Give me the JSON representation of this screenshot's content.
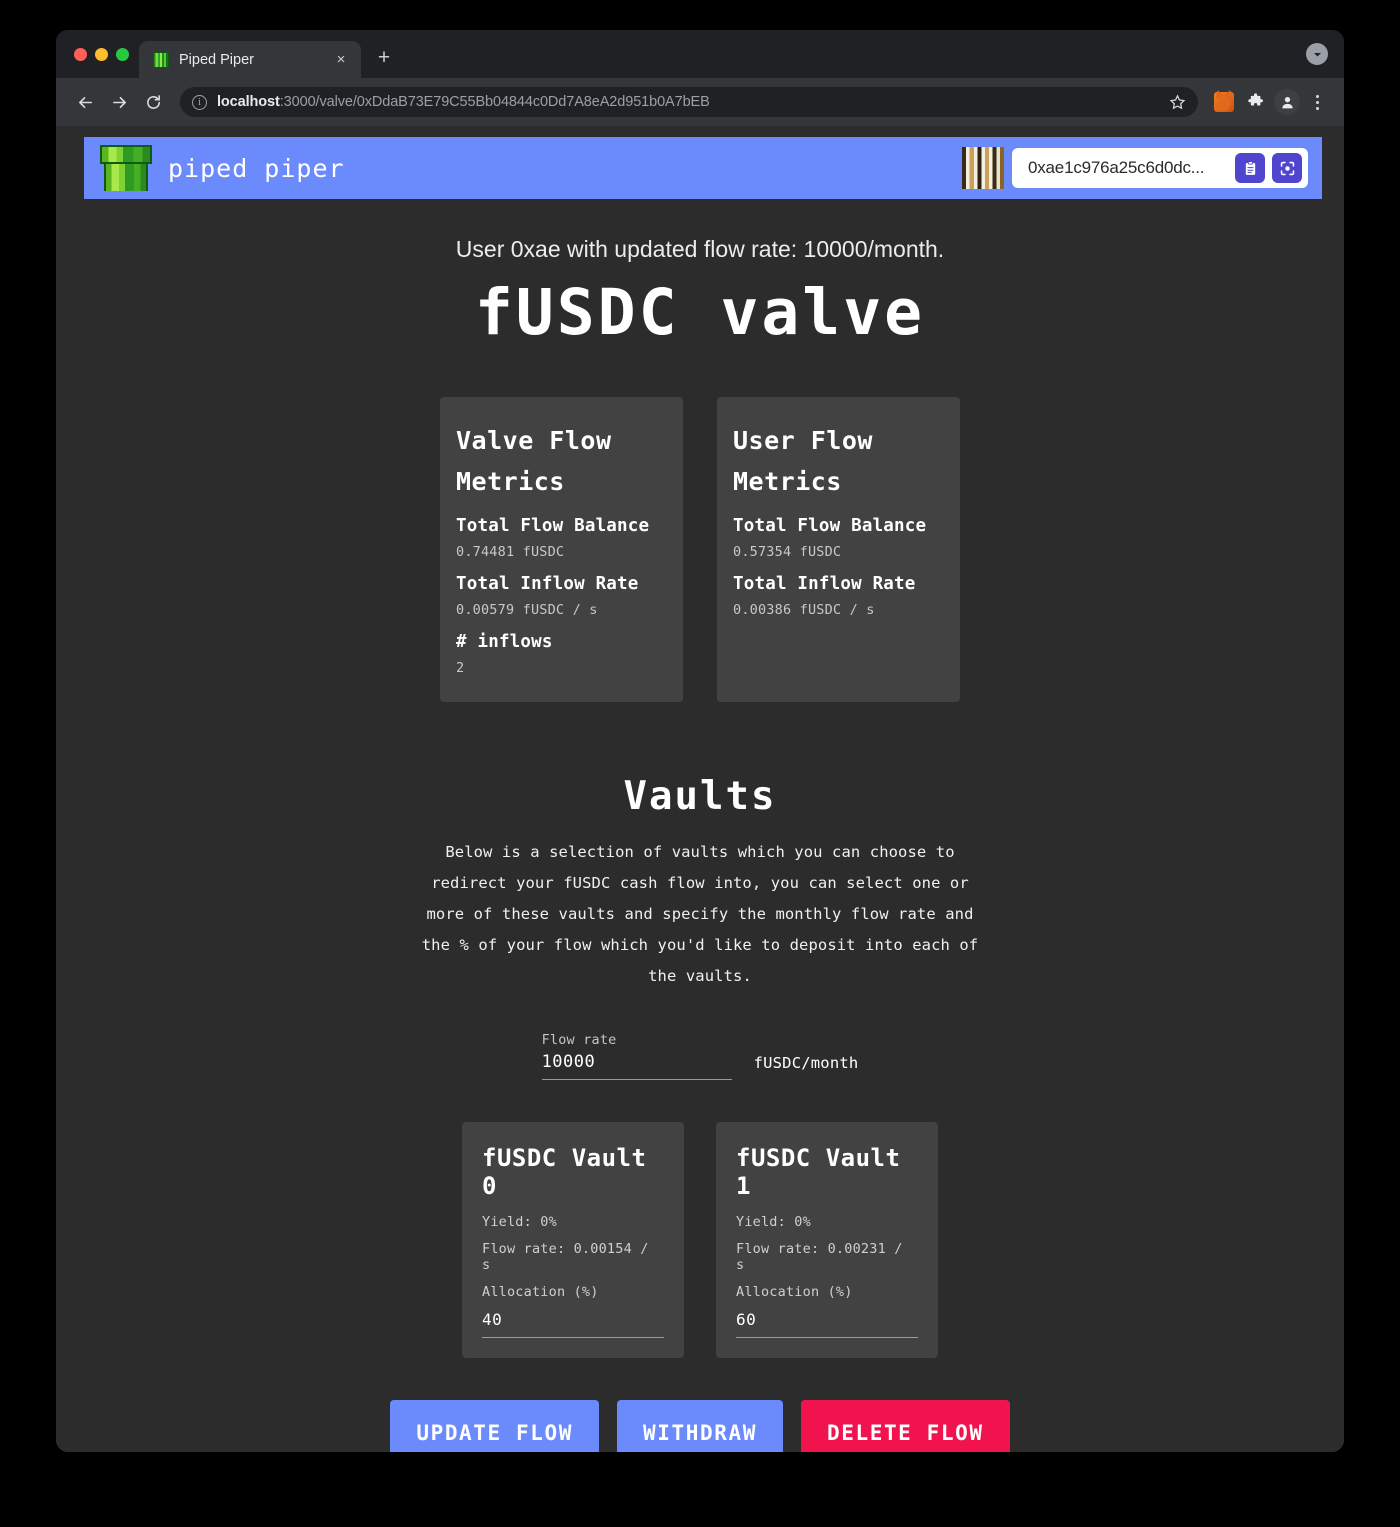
{
  "browser": {
    "tab": {
      "title": "Piped Piper",
      "favicon": "pipe-icon",
      "close_label": "×"
    },
    "new_tab_label": "+",
    "nav": {
      "back": "back-arrow-icon",
      "forward": "forward-arrow-icon",
      "reload": "reload-icon"
    },
    "url": {
      "info_icon": "info-icon",
      "host": "localhost",
      "rest": ":3000/valve/0xDdaB73E79C55Bb04844c0Dd7A8eA2d951b0A7bEB"
    },
    "toolbar_icons": [
      "star-icon",
      "metamask-fox-icon",
      "extensions-puzzle-icon",
      "profile-avatar-icon",
      "kebab-menu-icon"
    ]
  },
  "app": {
    "brand": "piped piper",
    "logo_icon": "green-pipe-icon",
    "wallet": {
      "avatar_icon": "identicon-avatar",
      "address": "0xae1c976a25c6d0dc...",
      "copy_icon": "clipboard-icon",
      "qr_icon": "qr-scan-icon"
    }
  },
  "main": {
    "status": "User 0xae with updated flow rate: 10000/month.",
    "title": "fUSDC valve",
    "metric_cards": [
      {
        "title": "Valve Flow Metrics",
        "rows": [
          {
            "label": "Total Flow Balance",
            "value": "0.74481 fUSDC"
          },
          {
            "label": "Total Inflow Rate",
            "value": "0.00579 fUSDC / s"
          },
          {
            "label": "# inflows",
            "value": "2"
          }
        ]
      },
      {
        "title": "User Flow Metrics",
        "rows": [
          {
            "label": "Total Flow Balance",
            "value": "0.57354 fUSDC"
          },
          {
            "label": "Total Inflow Rate",
            "value": "0.00386 fUSDC / s"
          }
        ]
      }
    ],
    "vaults": {
      "title": "Vaults",
      "description": "Below is a selection of vaults which you can choose to redirect your fUSDC cash flow into, you can select one or more of these vaults and specify the monthly flow rate and the % of your flow which you'd like to deposit into each of the vaults.",
      "flow_rate": {
        "label": "Flow rate",
        "value": "10000",
        "placeholder": "Flow rate",
        "unit": "fUSDC/month"
      },
      "cards": [
        {
          "name": "fUSDC Vault 0",
          "yield": "Yield: 0%",
          "flow_rate": "Flow rate: 0.00154 / s",
          "allocation_label": "Allocation (%)",
          "allocation_value": "40",
          "allocation_placeholder": "Allocation (%)"
        },
        {
          "name": "fUSDC Vault 1",
          "yield": "Yield: 0%",
          "flow_rate": "Flow rate: 0.00231 / s",
          "allocation_label": "Allocation (%)",
          "allocation_value": "60",
          "allocation_placeholder": "Allocation (%)"
        }
      ]
    },
    "actions": {
      "update": "UPDATE FLOW",
      "withdraw": "WITHDRAW",
      "delete": "DELETE FLOW"
    }
  },
  "colors": {
    "accent_blue": "#6b8afb",
    "danger": "#f0134d",
    "page_bg": "#2c2c2c",
    "card_bg": "#424242",
    "icon_indigo": "#4f45cf"
  }
}
